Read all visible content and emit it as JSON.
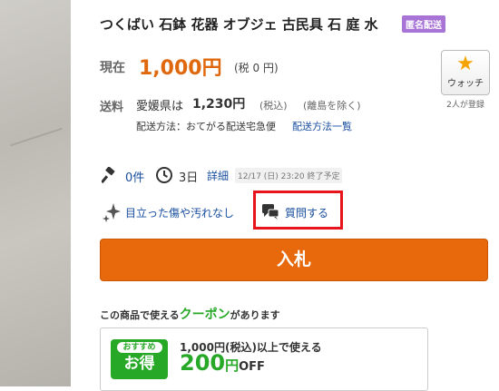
{
  "item": {
    "title": "つくばい 石鉢 花器 オブジェ 古民具 石 庭 水",
    "anon_badge": "匿名配送"
  },
  "price": {
    "label": "現在",
    "value": "1,000円",
    "tax": "(税 0 円)"
  },
  "watch": {
    "label": "ウォッチ",
    "count": "2人が登録"
  },
  "shipping": {
    "label": "送料",
    "destination": "愛媛県は",
    "price": "1,230円",
    "tax": "(税込)",
    "note": "(離島を除く)",
    "method": "配送方法：おてがる配送宅急便",
    "method_link": "配送方法一覧"
  },
  "bids": {
    "count": "0件",
    "remaining": "3日",
    "detail_link": "詳細",
    "end_time": "12/17 (日) 23:20 終了予定"
  },
  "condition": {
    "text": "目立った傷や汚れなし",
    "question_link": "質問する"
  },
  "bid_button": {
    "label": "入札"
  },
  "coupon": {
    "lead_prefix": "この商品で使える",
    "lead_highlight": "クーポン",
    "lead_suffix": "があります",
    "badge_rec": "おすすめ",
    "badge_deal": "お得",
    "condition": "1,000円(税込)以上で使える",
    "amount": "200",
    "yen": "円",
    "off": "OFF"
  },
  "colors": {
    "price": "#e0680c",
    "bid_button": "#e8680c",
    "link": "#1a4fa0",
    "coupon_green": "#27a827",
    "highlight_box": "#e8141c",
    "anon_badge": "#a874d6"
  },
  "icons": [
    "star-icon",
    "hammer-icon",
    "clock-icon",
    "sparkle-icon",
    "chat-icon"
  ]
}
